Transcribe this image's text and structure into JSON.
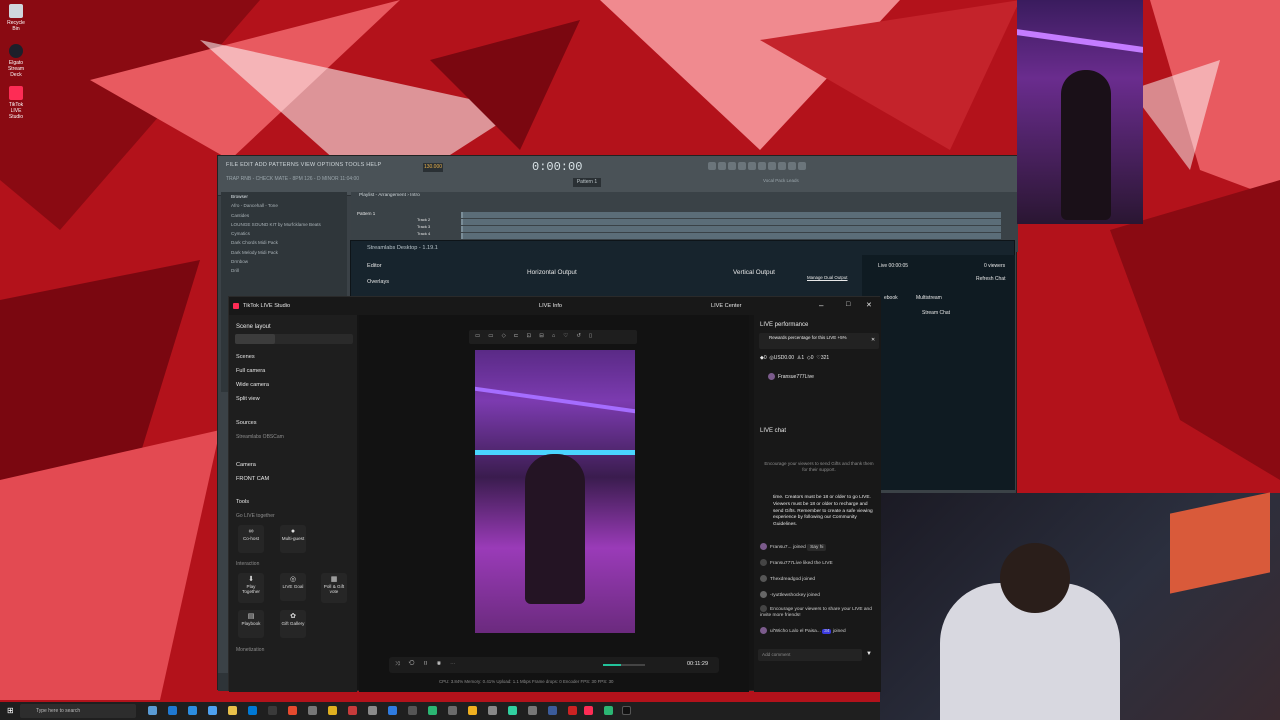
{
  "desktop": {
    "icons": [
      {
        "label": "Recycle Bin"
      },
      {
        "label": "Elgato Stream Deck"
      },
      {
        "label": "TikTok LIVE Studio"
      }
    ]
  },
  "fl": {
    "menu": "FILE  EDIT  ADD  PATTERNS  VIEW  OPTIONS  TOOLS  HELP",
    "time": "0:00:00",
    "tempo": "130.000",
    "song": "TRAP RNB - CHECK MATE - 8PM 126 - D MINOR",
    "song_time": "11:04:00",
    "pattern": "Pattern 1",
    "playlist_title": "Playlist - Arrangement › Intro",
    "news": "Vocal Pack Leads",
    "browser_title": "Browser",
    "browser_items": [
      "Afro - Dancehall - Tone",
      "Cantides",
      "LOUNGE SOUND KIT by Murfcklame Beats",
      "Cymatics",
      "Dark Chords Midi Pack",
      "Dark Melody Midi Pack",
      "Drmbow",
      "Drill"
    ],
    "tracks": [
      "Pattern 1",
      "Track 2",
      "Track 3",
      "Track 4"
    ]
  },
  "streamlabs": {
    "title": "Streamlabs Desktop - 1.19.1",
    "editor": "Editor",
    "overlays": "Overlays",
    "horizontal": "Horizontal Output",
    "vertical": "Vertical Output",
    "dual": "Manage Dual Output",
    "live_time": "Live 00:00:05",
    "viewers": "0 viewers",
    "refresh": "Refresh Chat",
    "tab1": "ebook",
    "tab2": "Multistream",
    "stream_chat": "Stream Chat"
  },
  "tiktok": {
    "app_title": "TikTok LIVE Studio",
    "live_info": "LIVE Info",
    "live_center": "LIVE Center",
    "scene_layout": "Scene layout",
    "scenes_label": "Scenes",
    "scenes": [
      "Full camera",
      "Wide camera",
      "Split view"
    ],
    "sources_label": "Sources",
    "sources_hidden": "Streamlabs OBSCam",
    "sources": [
      "Camera",
      "FRONT CAM"
    ],
    "tools_label": "Tools",
    "go_live_together": "Go LIVE together",
    "cohost": "Co-host",
    "multiguest": "Multi-guest",
    "interaction": "Interaction",
    "play_together": "Play Together",
    "live_goal": "LIVE Goal",
    "poll": "Poll & Gift vote",
    "playbook": "Playbook",
    "gift_gallery": "Gift Gallery",
    "monetization": "Monetization",
    "stream_time": "00:11:29",
    "stats": "CPU: 3.84%   Memory: 0.41%   Upload: 1.1 Mbps   Frame drops: 0   Encoder FPS: 30   FPS: 30",
    "live_performance": "LIVE performance",
    "rewards": "Rewards percentage for this LIVE +5%",
    "stat_coins": "0",
    "stat_usd": "USD0.00",
    "stat_users": "1",
    "stat_gifts": "0",
    "stat_likes": "321",
    "host": "Fransue777Live",
    "live_chat": "LIVE chat",
    "encourage": "Encourage your viewers to send Gifts and thank them for their support.",
    "guidelines": "time. Creators must be 18 or older to go LIVE. Viewers must be 18 or older to recharge and send Gifts. Remember to create a safe viewing experience by following our Community Guidelines.",
    "chat": [
      {
        "user": "Fransu7...",
        "action": "joined",
        "extra": "Say hi"
      },
      {
        "user": "Fransu777Live",
        "action": "liked the LIVE"
      },
      {
        "user": "Thexdreadgod",
        "action": "joined"
      },
      {
        "user": "-ryuttlewshockey",
        "action": "joined"
      },
      {
        "user": "",
        "action": "Encourage your viewers to share your LIVE and invite more friends!"
      },
      {
        "user": "ul'Wicho Lalo el Paisa...",
        "action": "joined",
        "extra": "34"
      }
    ],
    "comment_placeholder": "Add comment"
  },
  "taskbar": {
    "search": "Type here to search"
  },
  "colors": {
    "tiktok_bg": "#141414",
    "accent": "#fe2c55",
    "fl_bg": "#3b4247",
    "wall": "#b3121b"
  }
}
